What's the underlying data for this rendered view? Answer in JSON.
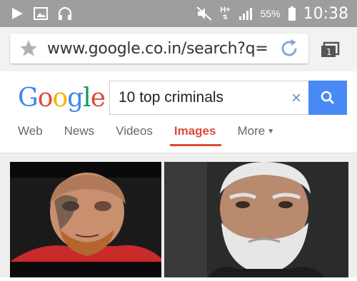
{
  "status_bar": {
    "battery_percent": "55%",
    "time": "10:38",
    "network": "H+",
    "icons": [
      "play-icon",
      "image-icon",
      "headset-icon",
      "mute-icon",
      "signal-icon",
      "battery-icon"
    ]
  },
  "browser": {
    "url": "www.google.co.in/search?q=",
    "icons": [
      "star-icon",
      "reload-icon",
      "tabs-icon"
    ]
  },
  "google": {
    "logo": "Google",
    "query": "10 top criminals",
    "clear_symbol": "×",
    "tabs": [
      {
        "label": "Web"
      },
      {
        "label": "News"
      },
      {
        "label": "Videos"
      },
      {
        "label": "Images"
      },
      {
        "label": "More"
      }
    ],
    "active_tab": "Images",
    "colors": {
      "blue": "#4285f4",
      "red": "#dd4b39",
      "yellow": "#f4b400",
      "green": "#0f9d58",
      "search_button": "#4a8af4"
    }
  },
  "results": {
    "images": [
      {
        "description_icon": "tattooed-face-image"
      },
      {
        "description_icon": "bearded-man-image"
      }
    ]
  }
}
